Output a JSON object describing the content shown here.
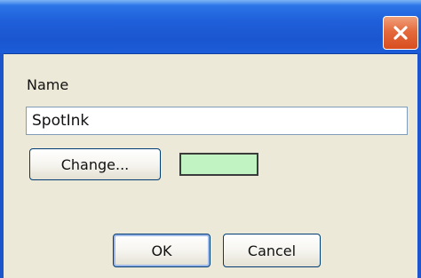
{
  "titlebar": {
    "title": "",
    "close_icon": "close-icon",
    "close_color": "#E0562A",
    "accent": "#1F5FD9"
  },
  "form": {
    "name_label": "Name",
    "name_value": "SpotInk",
    "change_label": "Change...",
    "swatch_color": "#C1F2C1"
  },
  "footer": {
    "ok_label": "OK",
    "cancel_label": "Cancel"
  }
}
